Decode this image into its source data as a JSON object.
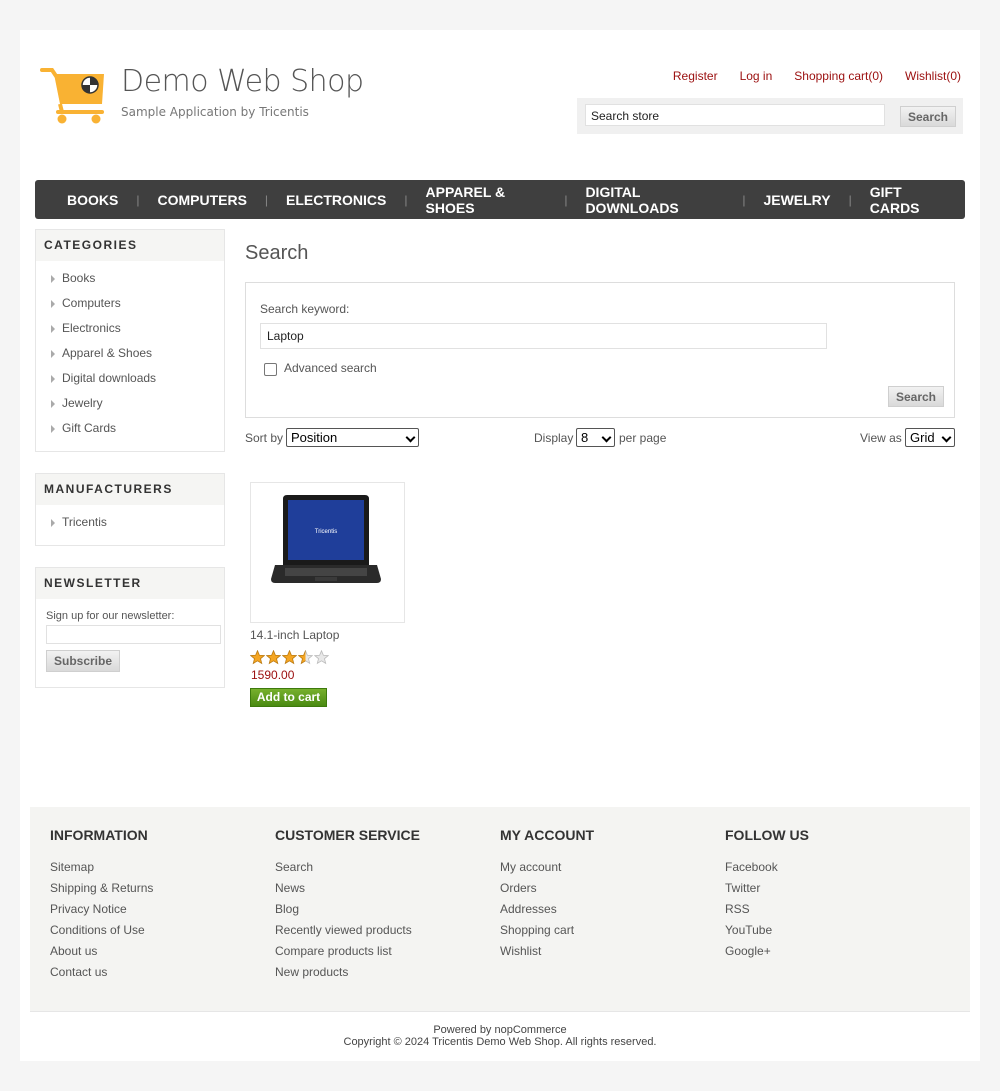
{
  "header": {
    "title": "Demo Web Shop",
    "subtitle": "Sample Application by Tricentis",
    "links": [
      "Register",
      "Log in",
      "Shopping cart(0)",
      "Wishlist(0)"
    ],
    "search": {
      "placeholder": "Search store",
      "button": "Search"
    },
    "colors": {
      "logo": "#f9b233",
      "link": "#9b0f0f"
    }
  },
  "topmenu": [
    "BOOKS",
    "COMPUTERS",
    "ELECTRONICS",
    "APPAREL & SHOES",
    "DIGITAL DOWNLOADS",
    "JEWELRY",
    "GIFT CARDS"
  ],
  "sidebar": {
    "categories": {
      "title": "CATEGORIES",
      "items": [
        "Books",
        "Computers",
        "Electronics",
        "Apparel & Shoes",
        "Digital downloads",
        "Jewelry",
        "Gift Cards"
      ]
    },
    "manufacturers": {
      "title": "MANUFACTURERS",
      "items": [
        "Tricentis"
      ]
    },
    "newsletter": {
      "title": "NEWSLETTER",
      "label": "Sign up for our newsletter:",
      "button": "Subscribe"
    }
  },
  "main": {
    "title": "Search",
    "form": {
      "keyword_label": "Search keyword:",
      "keyword_value": "Laptop",
      "advanced_label": "Advanced search",
      "advanced_checked": false,
      "button": "Search"
    },
    "sortbar": {
      "sort_label": "Sort by",
      "sort_value": "Position",
      "display_label": "Display",
      "display_value": "8",
      "per_page": "per page",
      "view_label": "View as",
      "view_value": "Grid"
    },
    "products": [
      {
        "title": "14.1-inch Laptop",
        "rating": 3.5,
        "rating_max": 5,
        "price": "1590.00",
        "button": "Add to cart",
        "screen_brand": "Tricentis"
      }
    ]
  },
  "footer": {
    "columns": [
      {
        "title": "INFORMATION",
        "links": [
          "Sitemap",
          "Shipping & Returns",
          "Privacy Notice",
          "Conditions of Use",
          "About us",
          "Contact us"
        ]
      },
      {
        "title": "CUSTOMER SERVICE",
        "links": [
          "Search",
          "News",
          "Blog",
          "Recently viewed products",
          "Compare products list",
          "New products"
        ]
      },
      {
        "title": "MY ACCOUNT",
        "links": [
          "My account",
          "Orders",
          "Addresses",
          "Shopping cart",
          "Wishlist"
        ]
      },
      {
        "title": "FOLLOW US",
        "links": [
          "Facebook",
          "Twitter",
          "RSS",
          "YouTube",
          "Google+"
        ]
      }
    ],
    "powered": "Powered by nopCommerce",
    "copyright": "Copyright © 2024 Tricentis Demo Web Shop. All rights reserved."
  }
}
